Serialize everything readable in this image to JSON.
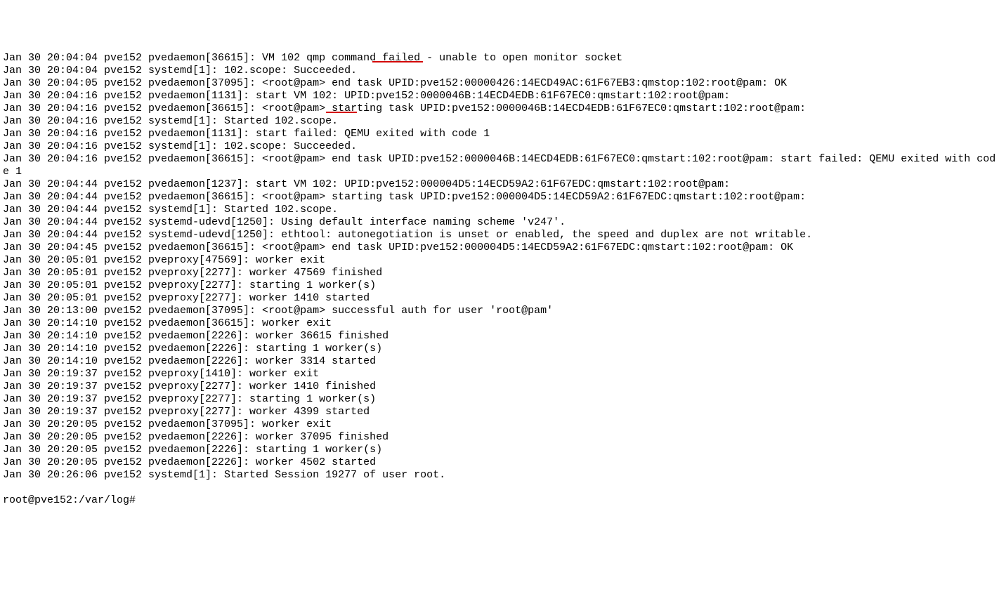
{
  "log": {
    "lines": [
      "Jan 30 20:04:04 pve152 pvedaemon[36615]: VM 102 qmp command failed - unable to open monitor socket",
      "Jan 30 20:04:04 pve152 systemd[1]: 102.scope: Succeeded.",
      "Jan 30 20:04:05 pve152 pvedaemon[37095]: <root@pam> end task UPID:pve152:00000426:14ECD49AC:61F67EB3:qmstop:102:root@pam: OK",
      "Jan 30 20:04:16 pve152 pvedaemon[1131]: start VM 102: UPID:pve152:0000046B:14ECD4EDB:61F67EC0:qmstart:102:root@pam:",
      "Jan 30 20:04:16 pve152 pvedaemon[36615]: <root@pam> starting task UPID:pve152:0000046B:14ECD4EDB:61F67EC0:qmstart:102:root@pam:",
      "Jan 30 20:04:16 pve152 systemd[1]: Started 102.scope.",
      "Jan 30 20:04:16 pve152 pvedaemon[1131]: start failed: QEMU exited with code 1",
      "Jan 30 20:04:16 pve152 systemd[1]: 102.scope: Succeeded.",
      "Jan 30 20:04:16 pve152 pvedaemon[36615]: <root@pam> end task UPID:pve152:0000046B:14ECD4EDB:61F67EC0:qmstart:102:root@pam: start failed: QEMU exited with code 1",
      "Jan 30 20:04:44 pve152 pvedaemon[1237]: start VM 102: UPID:pve152:000004D5:14ECD59A2:61F67EDC:qmstart:102:root@pam:",
      "Jan 30 20:04:44 pve152 pvedaemon[36615]: <root@pam> starting task UPID:pve152:000004D5:14ECD59A2:61F67EDC:qmstart:102:root@pam:",
      "Jan 30 20:04:44 pve152 systemd[1]: Started 102.scope.",
      "Jan 30 20:04:44 pve152 systemd-udevd[1250]: Using default interface naming scheme 'v247'.",
      "Jan 30 20:04:44 pve152 systemd-udevd[1250]: ethtool: autonegotiation is unset or enabled, the speed and duplex are not writable.",
      "Jan 30 20:04:45 pve152 pvedaemon[36615]: <root@pam> end task UPID:pve152:000004D5:14ECD59A2:61F67EDC:qmstart:102:root@pam: OK",
      "Jan 30 20:05:01 pve152 pveproxy[47569]: worker exit",
      "Jan 30 20:05:01 pve152 pveproxy[2277]: worker 47569 finished",
      "Jan 30 20:05:01 pve152 pveproxy[2277]: starting 1 worker(s)",
      "Jan 30 20:05:01 pve152 pveproxy[2277]: worker 1410 started",
      "Jan 30 20:13:00 pve152 pvedaemon[37095]: <root@pam> successful auth for user 'root@pam'",
      "Jan 30 20:14:10 pve152 pvedaemon[36615]: worker exit",
      "Jan 30 20:14:10 pve152 pvedaemon[2226]: worker 36615 finished",
      "Jan 30 20:14:10 pve152 pvedaemon[2226]: starting 1 worker(s)",
      "Jan 30 20:14:10 pve152 pvedaemon[2226]: worker 3314 started",
      "Jan 30 20:19:37 pve152 pveproxy[1410]: worker exit",
      "Jan 30 20:19:37 pve152 pveproxy[2277]: worker 1410 finished",
      "Jan 30 20:19:37 pve152 pveproxy[2277]: starting 1 worker(s)",
      "Jan 30 20:19:37 pve152 pveproxy[2277]: worker 4399 started",
      "Jan 30 20:20:05 pve152 pvedaemon[37095]: worker exit",
      "Jan 30 20:20:05 pve152 pvedaemon[2226]: worker 37095 finished",
      "Jan 30 20:20:05 pve152 pvedaemon[2226]: starting 1 worker(s)",
      "Jan 30 20:20:05 pve152 pvedaemon[2226]: worker 4502 started",
      "Jan 30 20:26:06 pve152 systemd[1]: Started Session 19277 of user root."
    ]
  },
  "prompt": "root@pve152:/var/log#"
}
